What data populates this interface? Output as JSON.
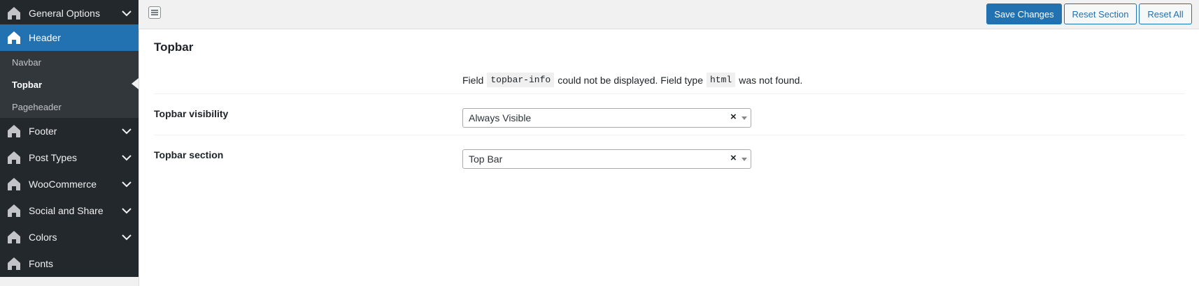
{
  "sidebar": {
    "items": [
      {
        "label": "General Options",
        "icon": "home-icon",
        "expandable": true
      },
      {
        "label": "Header",
        "icon": "home-icon",
        "active": true
      },
      {
        "label": "Footer",
        "icon": "home-icon",
        "expandable": true
      },
      {
        "label": "Post Types",
        "icon": "home-icon",
        "expandable": true
      },
      {
        "label": "WooCommerce",
        "icon": "home-icon",
        "expandable": true
      },
      {
        "label": "Social and Share",
        "icon": "home-icon",
        "expandable": true
      },
      {
        "label": "Colors",
        "icon": "home-icon",
        "expandable": true
      },
      {
        "label": "Fonts",
        "icon": "home-icon"
      }
    ],
    "submenu": [
      {
        "label": "Navbar"
      },
      {
        "label": "Topbar",
        "current": true
      },
      {
        "label": "Pageheader"
      }
    ]
  },
  "toolbar": {
    "save_label": "Save Changes",
    "reset_section_label": "Reset Section",
    "reset_all_label": "Reset All"
  },
  "main": {
    "section_title": "Topbar",
    "notice": {
      "prefix": "Field",
      "field_code": "topbar-info",
      "middle": "could not be displayed. Field type",
      "type_code": "html",
      "suffix": "was not found."
    },
    "fields": [
      {
        "label": "Topbar visibility",
        "value": "Always Visible"
      },
      {
        "label": "Topbar section",
        "value": "Top Bar"
      }
    ]
  },
  "colors": {
    "sidebar_bg": "#23282d",
    "active_bg": "#2271b1",
    "submenu_bg": "#32373c",
    "primary": "#2271b1"
  }
}
